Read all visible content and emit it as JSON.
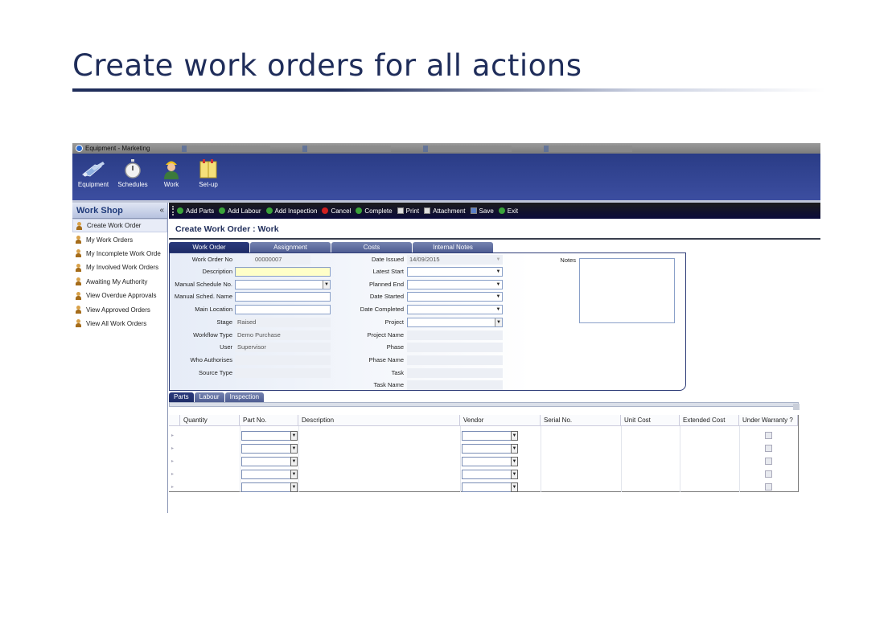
{
  "slide": {
    "title": "Create work orders for all actions"
  },
  "window": {
    "title": "Equipment - Marketing"
  },
  "ribbon": {
    "buttons": [
      {
        "label": "Equipment",
        "icon": "equipment-icon"
      },
      {
        "label": "Schedules",
        "icon": "stopwatch-icon"
      },
      {
        "label": "Work",
        "icon": "worker-icon"
      },
      {
        "label": "Set-up",
        "icon": "setup-icon"
      }
    ]
  },
  "sidebar": {
    "title": "Work Shop",
    "collapse": "«",
    "items": [
      "Create Work Order",
      "My Work Orders",
      "My Incomplete Work Orde",
      "My Involved Work Orders",
      "Awaiting My Authority",
      "View Overdue Approvals",
      "View Approved Orders",
      "View All Work Orders"
    ]
  },
  "toolbar": {
    "items": [
      {
        "label": "Add Parts",
        "color": "#3aa33a"
      },
      {
        "label": "Add Labour",
        "color": "#3aa33a"
      },
      {
        "label": "Add Inspection",
        "color": "#3aa33a"
      },
      {
        "label": "Cancel",
        "color": "#d02020"
      },
      {
        "label": "Complete",
        "color": "#3aa33a"
      },
      {
        "label": "Print",
        "color": "#cccccc"
      },
      {
        "label": "Attachment",
        "color": "#cccccc"
      },
      {
        "label": "Save",
        "color": "#5a7fc8"
      },
      {
        "label": "Exit",
        "color": "#3aa33a"
      }
    ]
  },
  "page": {
    "title": "Create Work Order : Work"
  },
  "tabs": [
    "Work Order",
    "Assignment",
    "Costs",
    "Internal Notes"
  ],
  "form": {
    "left": {
      "work_order_no": {
        "label": "Work Order No",
        "value": "00000007"
      },
      "description": {
        "label": "Description",
        "value": ""
      },
      "manual_schedule_no": {
        "label": "Manual Schedule No.",
        "value": ""
      },
      "manual_sched_name": {
        "label": "Manual Sched. Name",
        "value": ""
      },
      "main_location": {
        "label": "Main Location",
        "value": ""
      },
      "stage": {
        "label": "Stage",
        "value": "Raised"
      },
      "workflow_type": {
        "label": "Workflow Type",
        "value": "Demo Purchase"
      },
      "user": {
        "label": "User",
        "value": "Supervisor"
      },
      "who_authorises": {
        "label": "Who Authorises",
        "value": ""
      },
      "source_type": {
        "label": "Source Type",
        "value": ""
      }
    },
    "right": {
      "date_issued": {
        "label": "Date Issued",
        "value": "14/09/2015"
      },
      "latest_start": {
        "label": "Latest Start",
        "value": ""
      },
      "planned_end": {
        "label": "Planned End",
        "value": ""
      },
      "date_started": {
        "label": "Date Started",
        "value": ""
      },
      "date_completed": {
        "label": "Date Completed",
        "value": ""
      },
      "project": {
        "label": "Project",
        "value": ""
      },
      "project_name": {
        "label": "Project Name",
        "value": ""
      },
      "phase": {
        "label": "Phase",
        "value": ""
      },
      "phase_name": {
        "label": "Phase Name",
        "value": ""
      },
      "task": {
        "label": "Task",
        "value": ""
      },
      "task_name": {
        "label": "Task Name",
        "value": ""
      }
    },
    "notes_label": "Notes"
  },
  "subtabs": [
    "Parts",
    "Labour",
    "Inspection"
  ],
  "grid": {
    "columns": [
      "Quantity",
      "Part No.",
      "Description",
      "Vendor",
      "Serial No.",
      "Unit Cost",
      "Extended Cost",
      "Under Warranty ?"
    ]
  }
}
